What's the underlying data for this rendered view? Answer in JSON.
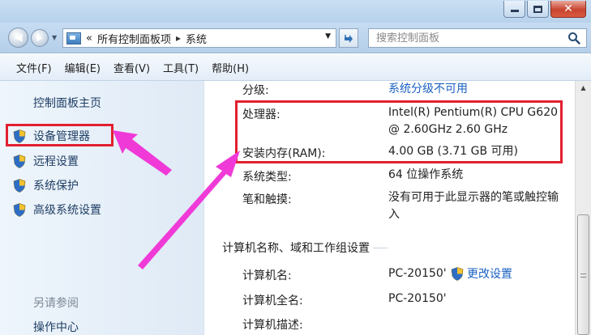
{
  "window": {
    "buttons": {
      "minimize": "minimize",
      "maximize": "maximize",
      "close": "close"
    }
  },
  "address": {
    "prefix": "«",
    "crumbs": [
      "所有控制面板项",
      "系统"
    ],
    "separator": "▸"
  },
  "search": {
    "placeholder": "搜索控制面板"
  },
  "menu": [
    "文件(F)",
    "编辑(E)",
    "查看(V)",
    "工具(T)",
    "帮助(H)"
  ],
  "sidebar": {
    "home": "控制面板主页",
    "links": [
      "设备管理器",
      "远程设置",
      "系统保护",
      "高级系统设置"
    ],
    "see_also": "另请参阅",
    "action_center": "操作中心"
  },
  "system": {
    "rating_label": "分级:",
    "rating_value": "系统分级不可用",
    "processor_label": "处理器:",
    "processor_value_line1": "Intel(R) Pentium(R) CPU G620",
    "processor_value_line2": "@ 2.60GHz   2.60 GHz",
    "ram_label": "安装内存(RAM):",
    "ram_value": "4.00 GB (3.71 GB 可用)",
    "type_label": "系统类型:",
    "type_value": "64 位操作系统",
    "pen_label": "笔和触摸:",
    "pen_value_line1": "没有可用于此显示器的笔或触控输",
    "pen_value_line2": "入"
  },
  "computer_section": {
    "title": "计算机名称、域和工作组设置",
    "name_label": "计算机名:",
    "name_value": "PC-20150'",
    "fullname_label": "计算机全名:",
    "fullname_value": "PC-20150'",
    "desc_label": "计算机描述:",
    "change_settings": "更改设置"
  },
  "colors": {
    "highlight_red": "#e21f2f",
    "arrow_magenta": "#f03ad8",
    "link_blue": "#1a61c1"
  }
}
